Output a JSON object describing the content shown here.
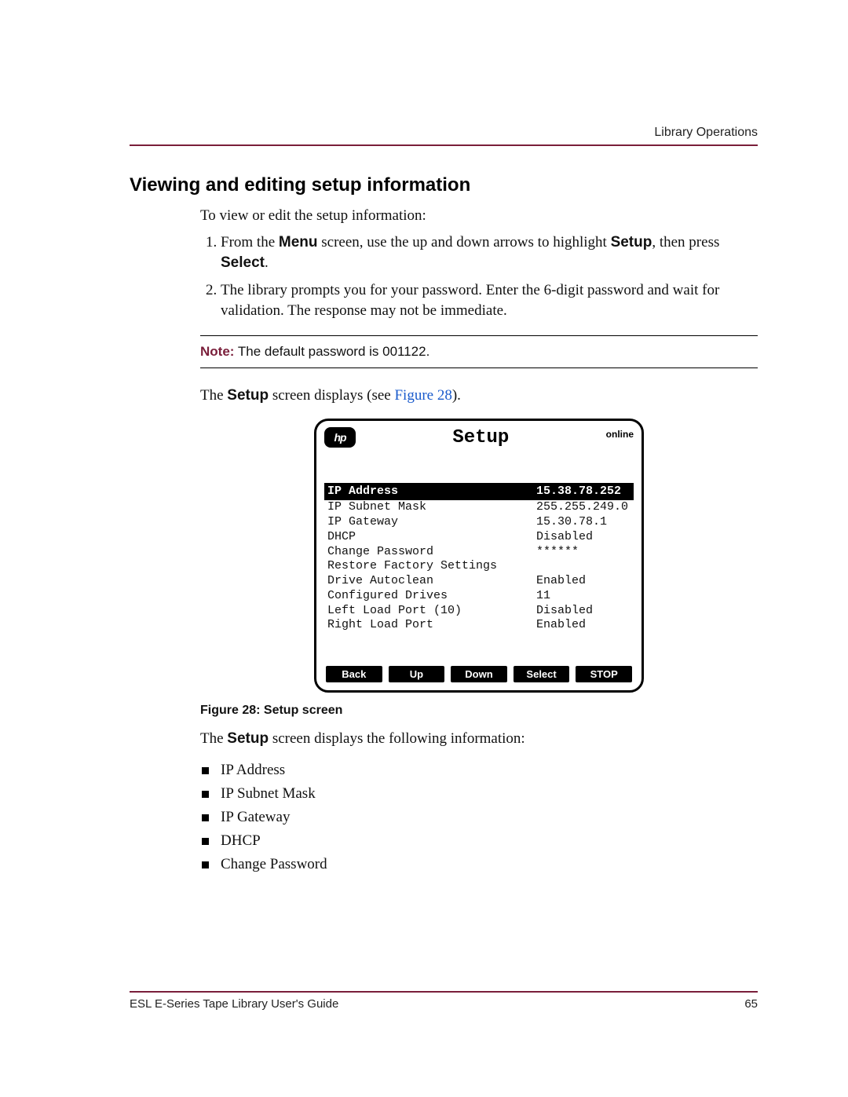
{
  "header": {
    "running": "Library Operations"
  },
  "heading": "Viewing and editing setup information",
  "lead": "To view or edit the setup information:",
  "steps": {
    "s1a": "From the ",
    "s1b": "Menu",
    "s1c": " screen, use the up and down arrows to highlight ",
    "s1d": "Setup",
    "s1e": ", then press ",
    "s1f": "Select",
    "s1g": ".",
    "s2": "The library prompts you for your password. Enter the 6-digit password and wait for validation. The response may not be immediate."
  },
  "note": {
    "label": "Note:",
    "text": "  The default password is 001122."
  },
  "displays": {
    "a": "The ",
    "b": "Setup",
    "c": " screen displays (see ",
    "link": "Figure 28",
    "d": ")."
  },
  "lcd": {
    "logo_text": "hp",
    "title": "Setup",
    "online": "online",
    "rows": [
      {
        "label": "IP Address",
        "value": "15.38.78.252",
        "highlight": true
      },
      {
        "label": "IP Subnet Mask",
        "value": "255.255.249.0"
      },
      {
        "label": "IP Gateway",
        "value": "15.30.78.1"
      },
      {
        "label": "DHCP",
        "value": "Disabled"
      },
      {
        "label": "Change Password",
        "value": "******"
      },
      {
        "label": "Restore Factory Settings",
        "value": ""
      },
      {
        "label": "Drive Autoclean",
        "value": "Enabled"
      },
      {
        "label": "Configured Drives",
        "value": "11"
      },
      {
        "label": "Left Load Port (10)",
        "value": "Disabled"
      },
      {
        "label": "Right Load Port",
        "value": "Enabled"
      }
    ],
    "buttons": [
      "Back",
      "Up",
      "Down",
      "Select",
      "STOP"
    ]
  },
  "caption": "Figure 28:  Setup screen",
  "post_caption": {
    "a": "The ",
    "b": "Setup",
    "c": " screen displays the following information:"
  },
  "bullets": [
    "IP Address",
    "IP Subnet Mask",
    "IP Gateway",
    "DHCP",
    "Change Password"
  ],
  "footer": {
    "left": "ESL E-Series Tape Library User's Guide",
    "right": "65"
  }
}
